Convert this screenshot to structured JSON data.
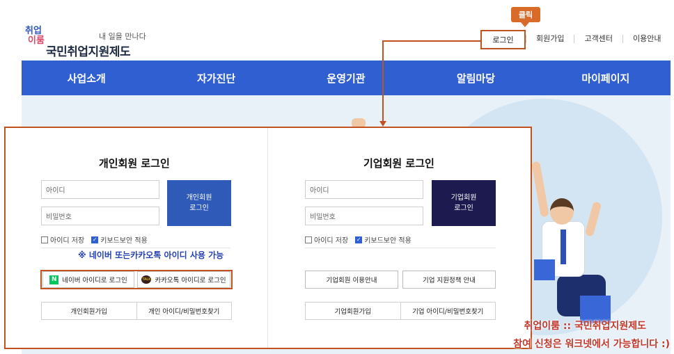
{
  "logo": {
    "mark_line1": "취업",
    "mark_line2": "이룸",
    "slogan": "내 일을 만나다",
    "name": "국민취업지원제도"
  },
  "annotation": {
    "click_tag": "클릭"
  },
  "topnav": {
    "login": "로그인",
    "items": [
      "회원가입",
      "고객센터",
      "이용안내"
    ]
  },
  "mainnav": [
    "사업소개",
    "자가진단",
    "운영기관",
    "알림마당",
    "마이페이지"
  ],
  "personal": {
    "title": "개인회원 로그인",
    "id_placeholder": "아이디",
    "pw_placeholder": "비밀번호",
    "login_line1": "개인회원",
    "login_line2": "로그인",
    "save_id": "아이디 저장",
    "keyboard_security": "키보드보안 적용",
    "social_note": "※ 네이버 또는카카오톡 아이디 사용 가능",
    "naver_login": "네이버 아이디로 로그인",
    "kakao_login": "카카오톡 아이디로 로그인",
    "signup": "개인회원가입",
    "find": "개인 아이디/비밀번호찾기",
    "login_color": "#2f5ab8"
  },
  "corporate": {
    "title": "기업회원 로그인",
    "id_placeholder": "아이디",
    "pw_placeholder": "비밀번호",
    "login_line1": "기업회원",
    "login_line2": "로그인",
    "save_id": "아이디 저장",
    "keyboard_security": "키보드보안 적용",
    "guide": "기업회원 이용안내",
    "policy": "기업 지원정책 안내",
    "signup": "기업회원가입",
    "find": "기업 아이디/비밀번호찾기",
    "login_color": "#1c1a4e"
  },
  "caption": {
    "line1": "취업이룸 :: 국민취업지원제도",
    "line2": "참여 신청은 워크넷에서 가능합니다 :)"
  },
  "colors": {
    "accent": "#2f5fd1",
    "annotation": "#c0521f"
  }
}
